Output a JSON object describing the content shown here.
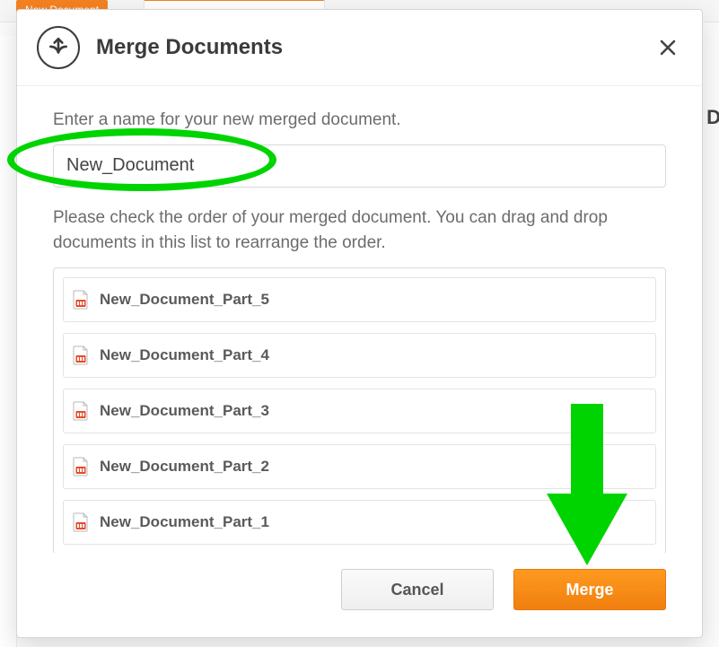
{
  "background": {
    "new_doc_btn": "New Document",
    "letter_right": "D"
  },
  "modal": {
    "title": "Merge Documents",
    "instruction_name": "Enter a name for your new merged document.",
    "name_value": "New_Document",
    "instruction_order": "Please check the order of your merged document. You can drag and drop documents in this list to rearrange the order.",
    "documents": [
      {
        "label": "New_Document_Part_5"
      },
      {
        "label": "New_Document_Part_4"
      },
      {
        "label": "New_Document_Part_3"
      },
      {
        "label": "New_Document_Part_2"
      },
      {
        "label": "New_Document_Part_1"
      }
    ],
    "cancel_label": "Cancel",
    "merge_label": "Merge"
  },
  "annotations": {
    "ellipse_color": "#00d400",
    "arrow_color": "#00d400"
  }
}
